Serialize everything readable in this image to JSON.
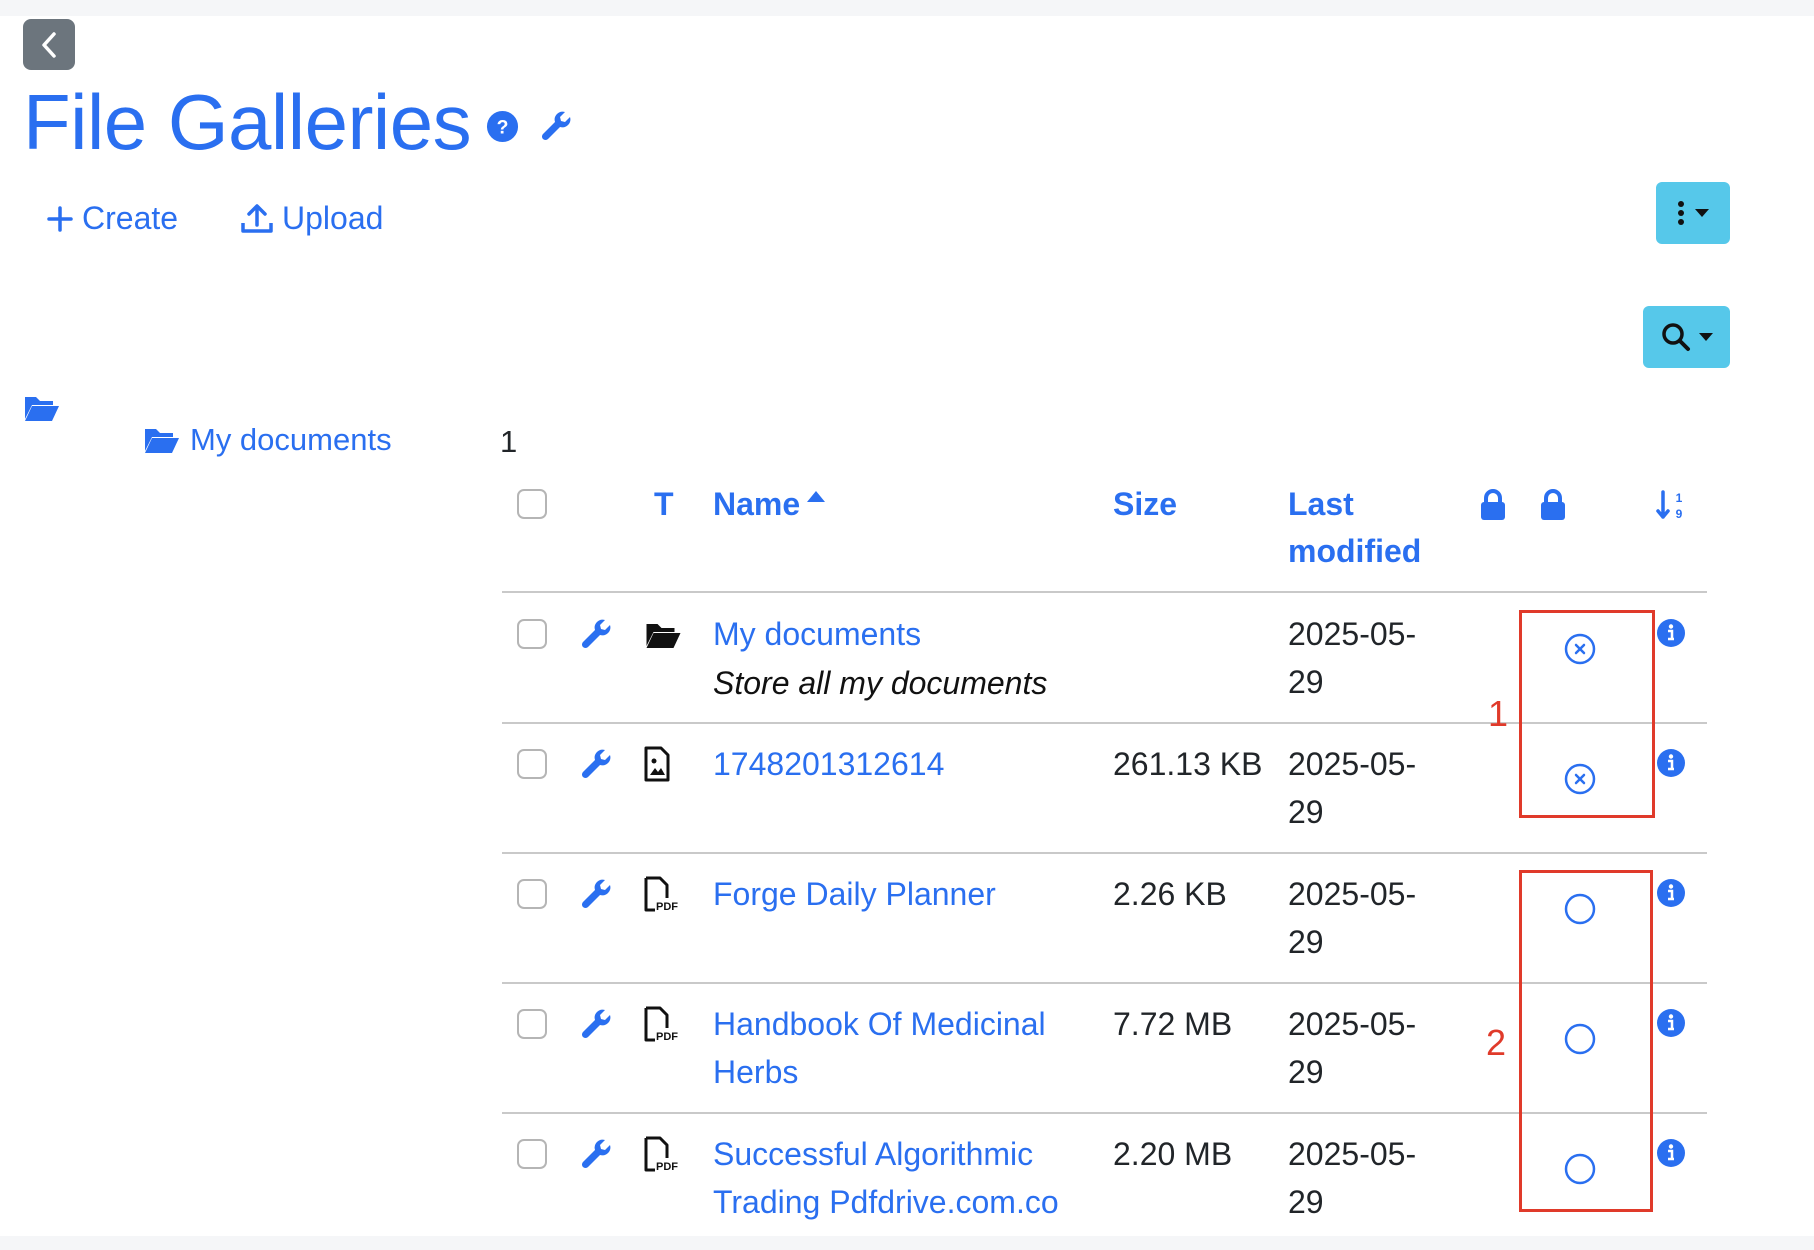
{
  "page": {
    "title": "File Galleries",
    "back_icon": "chevron-left-icon",
    "help_icon": "help-circle-icon",
    "admin_icon": "wrench-icon"
  },
  "actions": {
    "create_label": "Create",
    "upload_label": "Upload"
  },
  "toolbar": {
    "menu_icon": "kebab-menu-icon",
    "search_icon": "search-icon",
    "accent_color": "#56c8ea"
  },
  "tree": {
    "item_label": "My documents",
    "count": "1"
  },
  "table": {
    "headers": {
      "type": "T",
      "name": "Name",
      "size": "Size",
      "last_modified_line1": "Last",
      "last_modified_line2": "modified"
    },
    "rows": [
      {
        "type_icon": "folder-open-icon",
        "name": "My documents",
        "description": "Store all my documents",
        "size": "",
        "date_line1": "2025-05-",
        "date_line2": "29",
        "status_icon": "circle-x-icon"
      },
      {
        "type_icon": "image-file-icon",
        "name": "1748201312614",
        "size": "261.13 KB",
        "date_line1": "2025-05-",
        "date_line2": "29",
        "status_icon": "circle-x-icon"
      },
      {
        "type_icon": "pdf-file-icon",
        "name": "Forge Daily Planner",
        "size": "2.26 KB",
        "date_line1": "2025-05-",
        "date_line2": "29",
        "status_icon": "empty-circle-icon"
      },
      {
        "type_icon": "pdf-file-icon",
        "name_line1": "Handbook Of Medicinal",
        "name_line2": "Herbs",
        "size": "7.72 MB",
        "date_line1": "2025-05-",
        "date_line2": "29",
        "status_icon": "empty-circle-icon"
      },
      {
        "type_icon": "pdf-file-icon",
        "name_line1": "Successful Algorithmic",
        "name_line2": "Trading Pdfdrive.com.co",
        "size": "2.20 MB",
        "date_line1": "2025-05-",
        "date_line2": "29",
        "status_icon": "empty-circle-icon"
      }
    ]
  },
  "annotations": {
    "label_1": "1",
    "label_2": "2",
    "color": "#e03a2a"
  }
}
